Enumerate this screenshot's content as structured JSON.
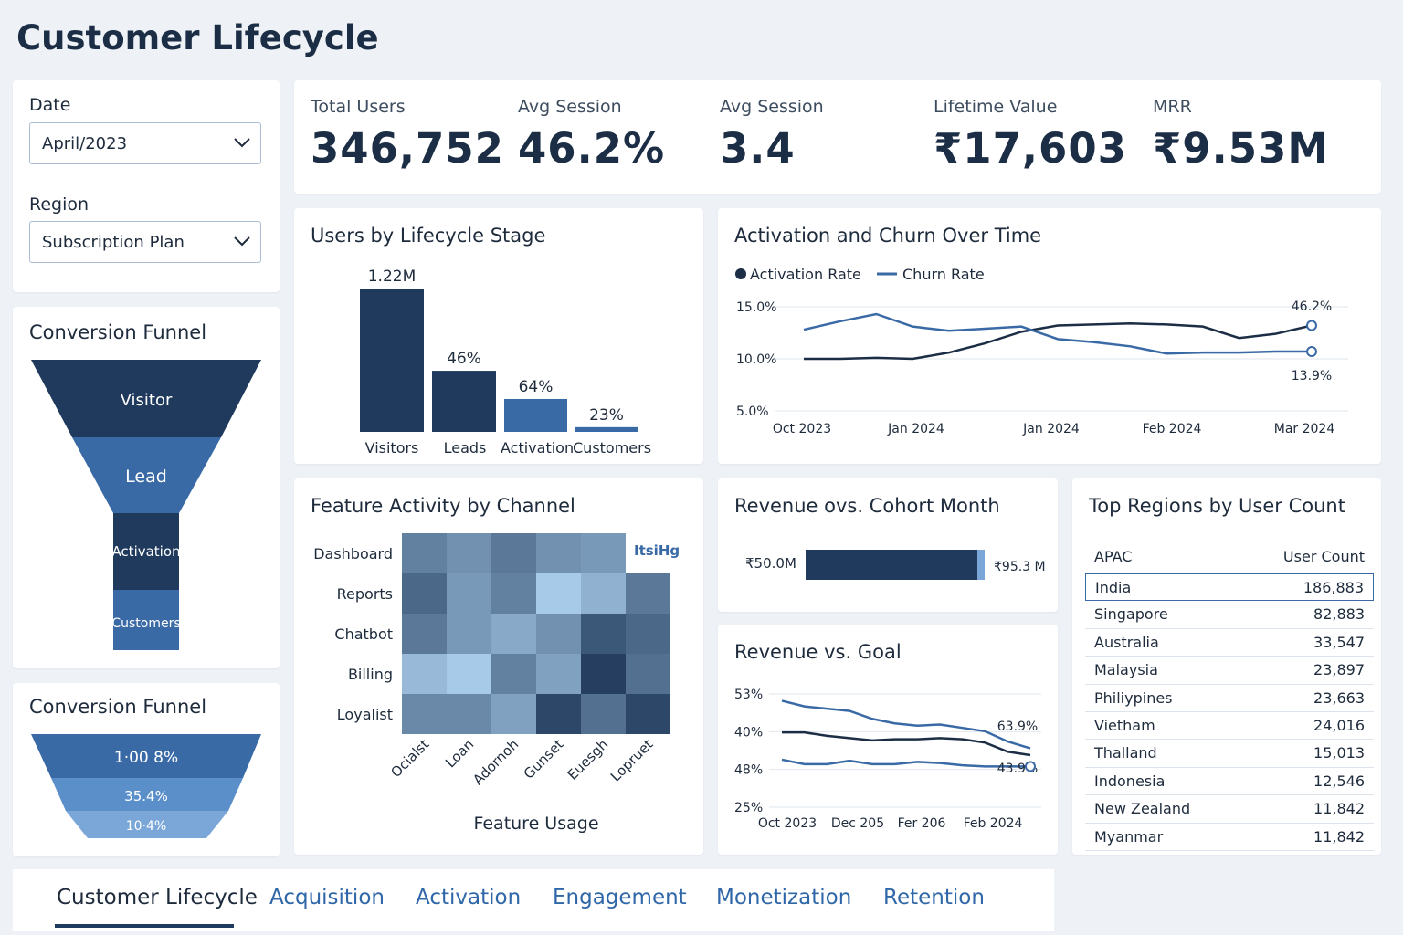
{
  "page_title": "Customer Lifecycle",
  "filters": {
    "date_label": "Date",
    "date_value": "April/2023",
    "region_label": "Region",
    "region_value": "Subscription Plan"
  },
  "kpis": [
    {
      "label": "Total Users",
      "value": "346,752"
    },
    {
      "label": "Avg Session",
      "value": "46.2%"
    },
    {
      "label": "Avg Session",
      "value": "3.4"
    },
    {
      "label": "Lifetime Value",
      "value": "₹17,603"
    },
    {
      "label": "MRR",
      "value": "₹9.53M"
    }
  ],
  "funnel_top": {
    "title": "Conversion Funnel",
    "stages": [
      "Visitor",
      "Lead",
      "Activation",
      "Customers"
    ]
  },
  "funnel_bottom": {
    "title": "Conversion Funnel",
    "stages": [
      "1·00 8%",
      "35.4%",
      "10·4%"
    ]
  },
  "lifecycle": {
    "title": "Users by Lifecycle Stage",
    "chart_data": {
      "type": "bar",
      "categories": [
        "Visitors",
        "Leads",
        "Activation",
        "Customers"
      ],
      "values": [
        1220000,
        520000,
        280000,
        40000
      ],
      "data_labels": [
        "1.22M",
        "46%",
        "64%",
        "23%"
      ]
    }
  },
  "activation_churn": {
    "title": "Activation and Churn Over Time",
    "chart_data": {
      "type": "line",
      "x_labels": [
        "Oct 2023",
        "Jan 2024",
        "Jan 2024",
        "Feb 2024",
        "Mar 2024"
      ],
      "y_ticks": [
        "15.0%",
        "10.0%",
        "5.0%"
      ],
      "ylim": [
        5,
        15
      ],
      "series": [
        {
          "name": "Activation Rate",
          "color": "#1c2e45",
          "end_label": "46.2%",
          "values": [
            10.0,
            10.0,
            10.1,
            10.0,
            10.6,
            11.5,
            12.6,
            13.2,
            13.3,
            13.4,
            13.3,
            13.1,
            12.0,
            12.4,
            13.2
          ]
        },
        {
          "name": "Churn Rate",
          "color": "#3a6aa6",
          "end_label": "13.9%",
          "values": [
            12.8,
            13.6,
            14.3,
            13.1,
            12.7,
            12.9,
            13.1,
            11.9,
            11.6,
            11.2,
            10.5,
            10.6,
            10.6,
            10.7,
            10.7
          ]
        }
      ]
    }
  },
  "heatmap": {
    "title": "Feature Activity by Channel",
    "legend_text": "ItsiHg",
    "xlabel": "Feature Usage",
    "chart_data": {
      "type": "heatmap",
      "rows": [
        "Dashboard",
        "Reports",
        "Chatbot",
        "Billing",
        "Loyalist"
      ],
      "cols": [
        "Ocialst",
        "Loan",
        "Adornoh",
        "Gunset",
        "Euesgh",
        "Lopruet"
      ],
      "values": [
        [
          0.55,
          0.45,
          0.6,
          0.45,
          0.4,
          null
        ],
        [
          0.7,
          0.4,
          0.55,
          0.1,
          0.25,
          0.6
        ],
        [
          0.6,
          0.4,
          0.3,
          0.45,
          0.8,
          0.7
        ],
        [
          0.2,
          0.1,
          0.55,
          0.35,
          0.95,
          0.65
        ],
        [
          0.5,
          0.5,
          0.35,
          0.9,
          0.65,
          0.9
        ]
      ]
    }
  },
  "revenue_cohort": {
    "title": "Revenue ovs. Cohort  Month",
    "chart_data": {
      "type": "bar",
      "left_label": "₹50.0M",
      "right_label": "₹95.3 M"
    }
  },
  "revenue_goal": {
    "title": "Revenue vs. Goal",
    "chart_data": {
      "type": "line",
      "x_labels": [
        "Oct 2023",
        "Dec 205",
        "Fer 206",
        "Feb 2024"
      ],
      "y_ticks": [
        "53%",
        "40%",
        "48%",
        "25%"
      ],
      "series": [
        {
          "color": "#3a6aa6",
          "end_label": "63.9%",
          "values": [
            0.94,
            0.89,
            0.87,
            0.85,
            0.78,
            0.74,
            0.72,
            0.73,
            0.7,
            0.67,
            0.58,
            0.52
          ]
        },
        {
          "color": "#1c2e45",
          "values": [
            0.66,
            0.66,
            0.63,
            0.61,
            0.59,
            0.6,
            0.6,
            0.61,
            0.6,
            0.57,
            0.49,
            0.46
          ]
        },
        {
          "color": "#3a6aa6",
          "end_label": "43.9%",
          "values": [
            0.42,
            0.38,
            0.38,
            0.41,
            0.38,
            0.38,
            0.4,
            0.39,
            0.37,
            0.36,
            0.36,
            0.36
          ]
        }
      ]
    }
  },
  "regions": {
    "title": "Top Regions by User Count",
    "header_region": "APAC",
    "header_count": "User Count",
    "rows": [
      {
        "name": "India",
        "count": "186,883"
      },
      {
        "name": "Singapore",
        "count": "82,883"
      },
      {
        "name": "Australia",
        "count": "33,547"
      },
      {
        "name": "Malaysia",
        "count": "23,897"
      },
      {
        "name": "Philiypines",
        "count": "23,663"
      },
      {
        "name": "Vietham",
        "count": "24,016"
      },
      {
        "name": "Thalland",
        "count": "15,013"
      },
      {
        "name": "Indonesia",
        "count": "12,546"
      },
      {
        "name": "New Zealand",
        "count": "11,842"
      },
      {
        "name": "Myanmar",
        "count": "11,842"
      }
    ]
  },
  "tabs": [
    "Customer Lifecycle",
    "Acquisition",
    "Activation",
    "Engagement",
    "Monetization",
    "Retention"
  ],
  "colors": {
    "dark": "#1c2e45",
    "mid": "#3a6aa6",
    "light": "#5b8fc9",
    "lighter": "#7aa6d8"
  }
}
